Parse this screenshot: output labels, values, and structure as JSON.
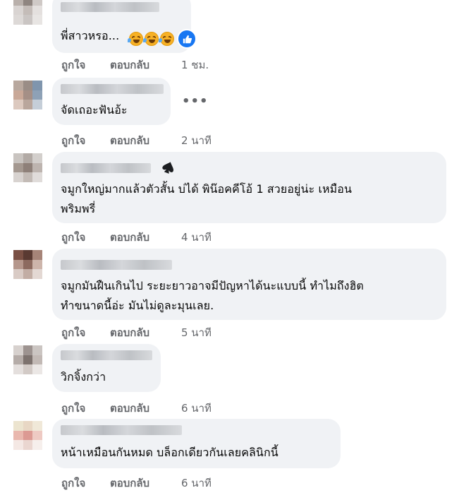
{
  "actions": {
    "like": "ถูกใจ",
    "reply": "ตอบกลับ"
  },
  "comments": [
    {
      "text_lines": [
        "พี่สาวหรอ..."
      ],
      "time": "1 ชม.",
      "reaction_icons": [
        "laughing-emoji",
        "laughing-emoji",
        "laughing-emoji",
        "like-icon"
      ]
    },
    {
      "text_lines": [
        "จัดเถอะฟันอ้ะ"
      ],
      "time": "2 นาที",
      "more_icon": "more-options-icon"
    },
    {
      "text_lines": [
        "จมูกใหญ่มากแล้วตัวสั้น บ่ได้ พิน๊อคคีโอ้ 1 สวยอยู่น่ะ เหมือน",
        "พริมพรี่"
      ],
      "time": "4 นาที",
      "badge_icon": "spade-icon"
    },
    {
      "text_lines": [
        "จมูกมันฝืนเกินไป ระยะยาวอาจมีปัญหาได้นะแบบนี้ ทำไมถึงฮิต",
        "ทำขนาดนี้อ่ะ มันไม่ดูละมุนเลย."
      ],
      "time": "5 นาที"
    },
    {
      "text_lines": [
        "วิกจิ้งกว่า"
      ],
      "time": "6 นาที"
    },
    {
      "text_lines": [
        "หน้าเหมือนกันหมด บล็อกเดียวกันเลยคลินิกนี้"
      ],
      "time": "6 นาที"
    }
  ]
}
